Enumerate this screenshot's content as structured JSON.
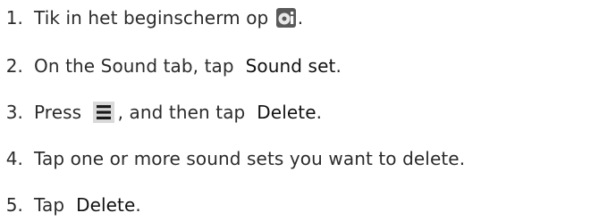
{
  "steps": [
    {
      "number": "1.",
      "text_before": "Tik in het beginscherm op ",
      "icon": "settings-icon",
      "text_after": "."
    },
    {
      "number": "2.",
      "text_before": "On the Sound tab, tap ",
      "emphasis": "Sound set",
      "text_after": "."
    },
    {
      "number": "3.",
      "text_before": "Press ",
      "icon": "menu-icon",
      "text_middle": ", and then tap ",
      "emphasis": "Delete",
      "text_after": "."
    },
    {
      "number": "4.",
      "text": "Tap one or more sound sets you want to delete."
    },
    {
      "number": "5.",
      "text_before": "Tap ",
      "emphasis": "Delete",
      "text_after": "."
    }
  ]
}
